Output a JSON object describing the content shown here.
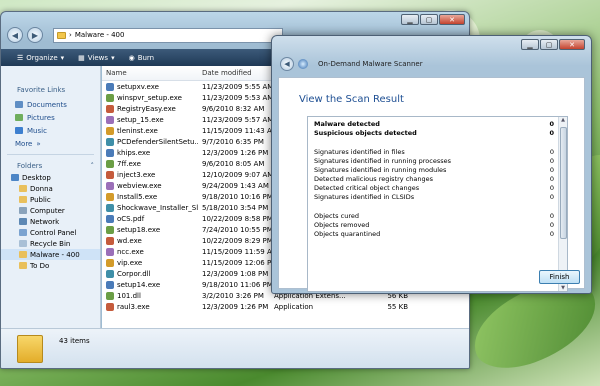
{
  "explorer": {
    "address_path": "Malware - 400",
    "toolbar": {
      "organize": "Organize",
      "views": "Views",
      "burn": "Burn"
    },
    "sidebar": {
      "favorite_links_heading": "Favorite Links",
      "links": [
        "Documents",
        "Pictures",
        "Music"
      ],
      "more": "More",
      "folders_heading": "Folders",
      "tree": [
        "Desktop",
        "Donna",
        "Public",
        "Computer",
        "Network",
        "Control Panel",
        "Recycle Bin",
        "Malware - 400",
        "To Do"
      ],
      "selected_folder": "Malware - 400"
    },
    "columns": {
      "name": "Name",
      "date_modified": "Date modified"
    },
    "files": [
      {
        "name": "setupxv.exe",
        "date": "11/23/2009 5:55 AM",
        "type": "",
        "size": ""
      },
      {
        "name": "winspvr_setup.exe",
        "date": "11/23/2009 5:53 AM",
        "type": "",
        "size": ""
      },
      {
        "name": "RegistryEasy.exe",
        "date": "9/6/2010 8:32 AM",
        "type": "",
        "size": ""
      },
      {
        "name": "setup_15.exe",
        "date": "11/23/2009 5:57 AM",
        "type": "",
        "size": ""
      },
      {
        "name": "tleninst.exe",
        "date": "11/15/2009 11:43 AM",
        "type": "",
        "size": ""
      },
      {
        "name": "PCDefenderSilentSetu...",
        "date": "9/7/2010 6:35 PM",
        "type": "",
        "size": ""
      },
      {
        "name": "khips.exe",
        "date": "12/3/2009 1:26 PM",
        "type": "",
        "size": ""
      },
      {
        "name": "7ff.exe",
        "date": "9/6/2010 8:05 AM",
        "type": "",
        "size": ""
      },
      {
        "name": "inject3.exe",
        "date": "12/10/2009 9:07 AM",
        "type": "",
        "size": ""
      },
      {
        "name": "webview.exe",
        "date": "9/24/2009 1:43 AM",
        "type": "",
        "size": ""
      },
      {
        "name": "Install5.exe",
        "date": "9/18/2010 10:16 PM",
        "type": "",
        "size": ""
      },
      {
        "name": "Shockwave_Installer_Sl...",
        "date": "5/18/2010 3:54 PM",
        "type": "",
        "size": ""
      },
      {
        "name": "oCS.pdf",
        "date": "10/22/2009 8:58 PM",
        "type": "",
        "size": ""
      },
      {
        "name": "setup18.exe",
        "date": "7/24/2010 10:55 PM",
        "type": "",
        "size": ""
      },
      {
        "name": "wd.exe",
        "date": "10/22/2009 8:29 PM",
        "type": "",
        "size": ""
      },
      {
        "name": "ncc.exe",
        "date": "11/15/2009 11:59 AM",
        "type": "",
        "size": ""
      },
      {
        "name": "vip.exe",
        "date": "11/15/2009 12:06 PM",
        "type": "",
        "size": ""
      },
      {
        "name": "Corpor.dll",
        "date": "12/3/2009 1:08 PM",
        "type": "",
        "size": ""
      },
      {
        "name": "setup14.exe",
        "date": "9/18/2010 11:06 PM",
        "type": "",
        "size": ""
      },
      {
        "name": "101.dll",
        "date": "3/2/2010 3:26 PM",
        "type": "Application Extens...",
        "size": "56 KB"
      },
      {
        "name": "raul3.exe",
        "date": "12/3/2009 1:26 PM",
        "type": "Application",
        "size": "55 KB"
      }
    ],
    "status_items": "43 items"
  },
  "scanner": {
    "title": "On-Demand Malware Scanner",
    "heading": "View the Scan Result",
    "results": [
      {
        "label": "Malware detected",
        "value": "0",
        "bold": true
      },
      {
        "label": "Suspicious objects detected",
        "value": "0",
        "bold": true
      },
      {
        "label": "Signatures identified in files",
        "value": "0",
        "bold": false
      },
      {
        "label": "Signatures identified in running processes",
        "value": "0",
        "bold": false
      },
      {
        "label": "Signatures identified in running modules",
        "value": "0",
        "bold": false
      },
      {
        "label": "Detected malicious registry changes",
        "value": "0",
        "bold": false
      },
      {
        "label": "Detected critical object changes",
        "value": "0",
        "bold": false
      },
      {
        "label": "Signatures identified in CLSIDs",
        "value": "0",
        "bold": false
      },
      {
        "label": "Objects cured",
        "value": "0",
        "bold": false
      },
      {
        "label": "Objects removed",
        "value": "0",
        "bold": false
      },
      {
        "label": "Objects quarantined",
        "value": "0",
        "bold": false
      }
    ],
    "finish_label": "Finish"
  },
  "colors": {
    "accent": "#1e4f93",
    "toolbar": "#2b4868",
    "link": "#1e4d8c"
  }
}
